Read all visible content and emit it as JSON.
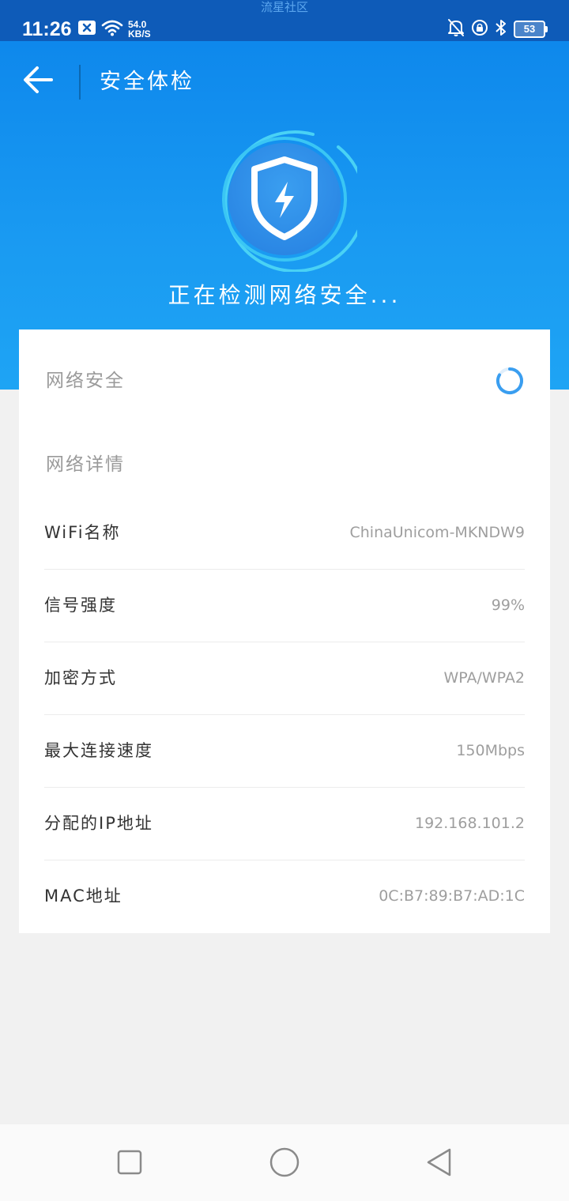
{
  "status_bar": {
    "watermark": "流星社区",
    "time": "11:26",
    "net_speed_value": "54.0",
    "net_speed_unit": "KB/S",
    "battery_level": "53"
  },
  "header": {
    "title": "安全体检",
    "scan_status": "正在检测网络安全..."
  },
  "security": {
    "label": "网络安全"
  },
  "details": {
    "heading": "网络详情",
    "rows": [
      {
        "label": "WiFi名称",
        "value": "ChinaUnicom-MKNDW9"
      },
      {
        "label": "信号强度",
        "value": "99%"
      },
      {
        "label": "加密方式",
        "value": "WPA/WPA2"
      },
      {
        "label": "最大连接速度",
        "value": "150Mbps"
      },
      {
        "label": "分配的IP地址",
        "value": "192.168.101.2"
      },
      {
        "label": "MAC地址",
        "value": "0C:B7:89:B7:AD:1C"
      }
    ]
  },
  "colors": {
    "header_blue": "#1a9bf2",
    "status_bar_blue": "#0e5bb8",
    "accent": "#1e90e8"
  },
  "icons": {
    "back": "back-arrow-icon",
    "shield": "shield-lightning-icon",
    "spinner": "loading-spinner-icon"
  }
}
